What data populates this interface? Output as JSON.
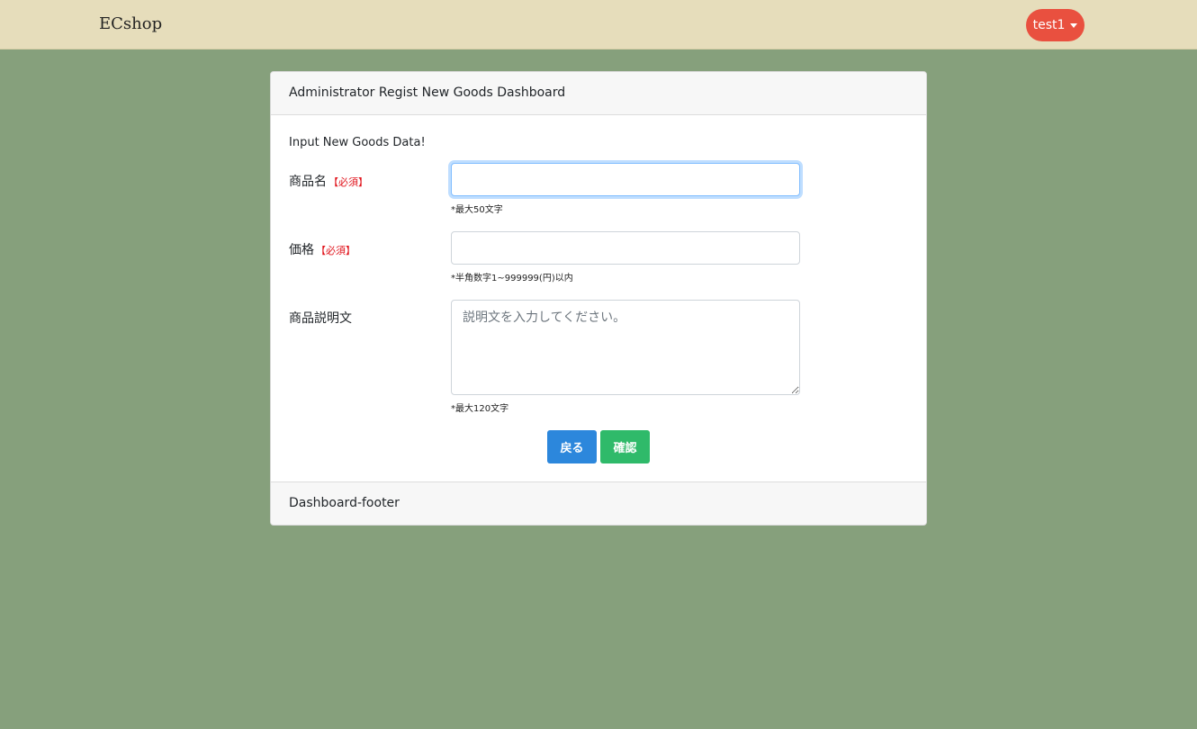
{
  "navbar": {
    "brand": "ECshop",
    "user_label": "test1"
  },
  "card": {
    "header": "Administrator Regist New Goods Dashboard",
    "intro": "Input New Goods Data!",
    "footer": "Dashboard-footer"
  },
  "form": {
    "name": {
      "label": "商品名",
      "required": "【必須】",
      "value": "",
      "hint": "*最大50文字"
    },
    "price": {
      "label": "価格",
      "required": "【必須】",
      "value": "",
      "hint": "*半角数字1~999999(円)以内"
    },
    "description": {
      "label": "商品説明文",
      "placeholder": "説明文を入力してください。",
      "value": "",
      "hint": "*最大120文字"
    }
  },
  "buttons": {
    "back": "戻る",
    "confirm": "確認"
  },
  "colors": {
    "background": "#86a07c",
    "navbar": "#e6ddbb",
    "user_button": "#e9503f",
    "back_button": "#2c87dc",
    "confirm_button": "#2fba6a",
    "required": "#e0131b"
  }
}
